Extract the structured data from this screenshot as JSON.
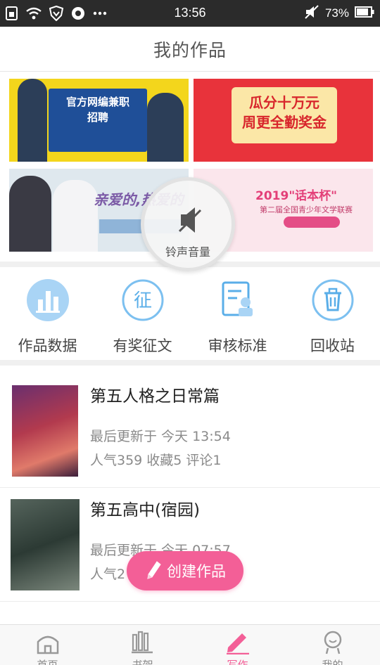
{
  "status_bar": {
    "time": "13:56",
    "battery": "73%",
    "icons": [
      "sim-icon",
      "wifi-icon",
      "shield-icon",
      "sync-icon",
      "more-dots-icon",
      "mute-icon",
      "battery-icon"
    ]
  },
  "header": {
    "title": "我的作品"
  },
  "banners": [
    {
      "text": "官方网编兼职\n招聘",
      "icon": "banner-recruit"
    },
    {
      "text": "瓜分十万元\n周更全勤奖金",
      "icon": "banner-bonus"
    },
    {
      "text": "亲爱的,热爱的",
      "icon": "banner-drama"
    },
    {
      "text": "2019\"话本杯\"",
      "subtext": "第二届全国青少年文学联赛",
      "icon": "banner-contest"
    }
  ],
  "volume_overlay": {
    "label": "铃声音量",
    "icon": "speaker-muted-icon"
  },
  "actions": [
    {
      "label": "作品数据",
      "icon": "bar-chart-icon"
    },
    {
      "label": "有奖征文",
      "icon": "contest-badge-icon"
    },
    {
      "label": "审核标准",
      "icon": "review-doc-icon"
    },
    {
      "label": "回收站",
      "icon": "trash-icon"
    }
  ],
  "works": [
    {
      "title": "第五人格之日常篇",
      "updated": "最后更新于 今天 13:54",
      "stats": "人气359 收藏5 评论1"
    },
    {
      "title": "第五高中(宿园)",
      "updated": "最后更新于 今天 07:57",
      "stats": "人气2"
    }
  ],
  "create_button": {
    "label": "创建作品",
    "icon": "pencil-icon"
  },
  "bottom_nav": [
    {
      "label": "首页",
      "icon": "home-icon",
      "active": false
    },
    {
      "label": "书架",
      "icon": "bookshelf-icon",
      "active": false
    },
    {
      "label": "写作",
      "icon": "pen-icon",
      "active": true
    },
    {
      "label": "我的",
      "icon": "profile-icon",
      "active": false
    }
  ],
  "colors": {
    "accent": "#f35f97",
    "action_icon": "#5aaee8"
  }
}
